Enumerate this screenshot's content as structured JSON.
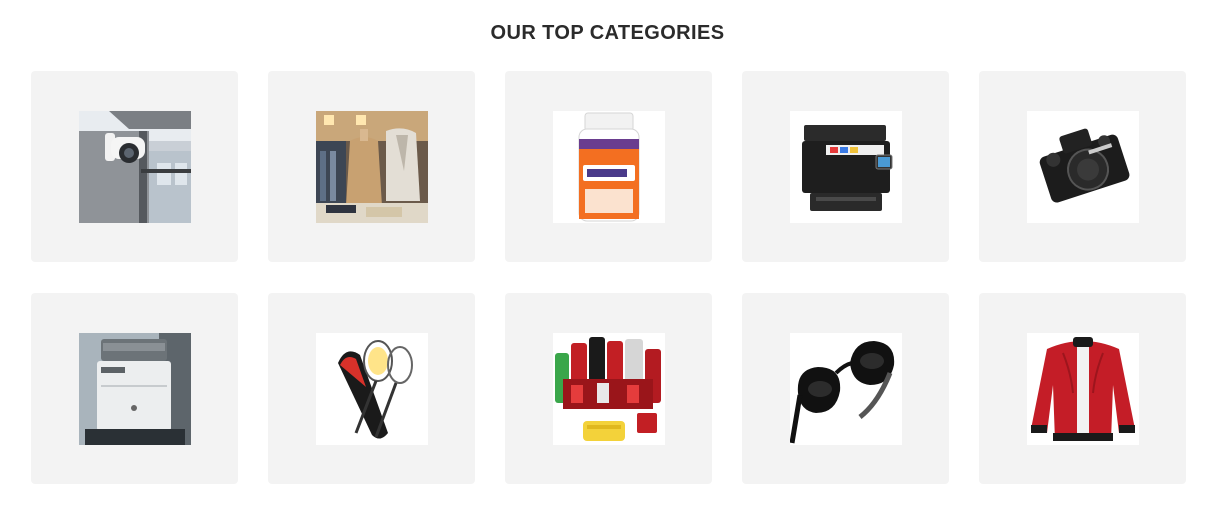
{
  "section": {
    "title": "OUR TOP CATEGORIES"
  },
  "categories": [
    {
      "icon": "security-camera-icon"
    },
    {
      "icon": "clothing-store-icon"
    },
    {
      "icon": "vitamin-bottle-icon"
    },
    {
      "icon": "printer-icon"
    },
    {
      "icon": "camera-icon"
    },
    {
      "icon": "laser-printer-icon"
    },
    {
      "icon": "badminton-racket-icon"
    },
    {
      "icon": "car-care-products-icon"
    },
    {
      "icon": "sunglasses-icon"
    },
    {
      "icon": "red-jacket-icon"
    }
  ]
}
